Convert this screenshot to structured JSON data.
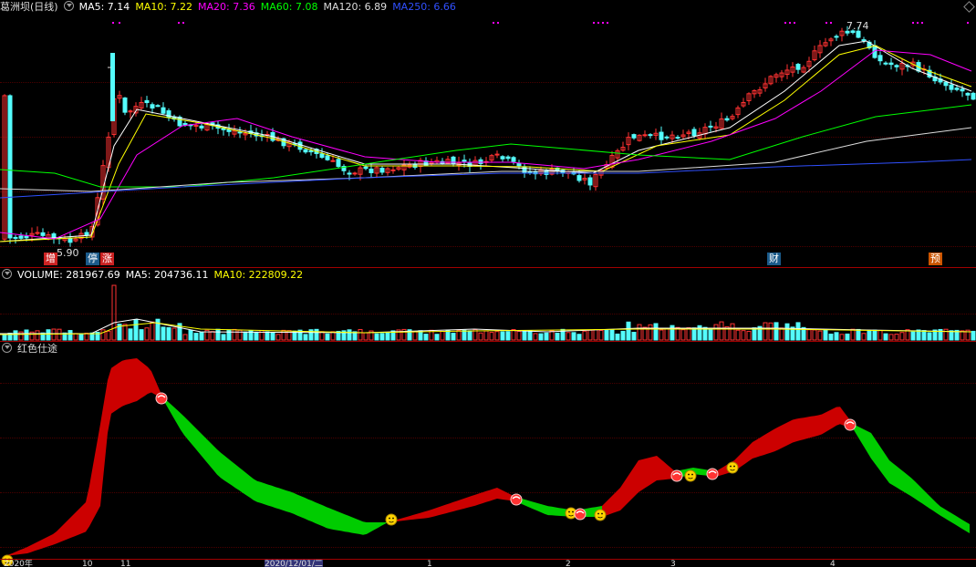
{
  "main": {
    "title": "葛洲坝(日线)",
    "ma": [
      {
        "label": "MA5: 7.14",
        "color": "#ffffff"
      },
      {
        "label": "MA10: 7.22",
        "color": "#ffff00"
      },
      {
        "label": "MA20: 7.36",
        "color": "#ff00ff"
      },
      {
        "label": "MA60: 7.08",
        "color": "#00ff00"
      },
      {
        "label": "MA120: 6.89",
        "color": "#dddddd"
      },
      {
        "label": "MA250: 6.66",
        "color": "#3050ff"
      }
    ],
    "high_label": "7.74",
    "low_label": "5.90",
    "badges": [
      {
        "text": "增",
        "bg": "#cc2222"
      },
      {
        "text": "停",
        "bg": "#1a5a8a"
      },
      {
        "text": "涨",
        "bg": "#cc2222"
      },
      {
        "text": "财",
        "bg": "#1a5a8a"
      },
      {
        "text": "预",
        "bg": "#cc5500"
      }
    ]
  },
  "volume": {
    "items": [
      {
        "label": "VOLUME: 281967.69",
        "color": "#ffffff"
      },
      {
        "label": "MA5: 204736.11",
        "color": "#ffffff"
      },
      {
        "label": "MA10: 222809.22",
        "color": "#ffff00"
      }
    ]
  },
  "indicator": {
    "title": "红色仕途"
  },
  "axis": {
    "labels": [
      "2020年",
      "10",
      "11",
      "2020/12/01/二",
      "1",
      "2",
      "3",
      "4"
    ]
  },
  "chart_data": {
    "type": "candlestick",
    "price_high": 7.74,
    "price_low": 5.9,
    "ma_values": {
      "MA5": 7.14,
      "MA10": 7.22,
      "MA20": 7.36,
      "MA60": 7.08,
      "MA120": 6.89,
      "MA250": 6.66
    },
    "volume_values": {
      "VOLUME": 281967.69,
      "MA5": 204736.11,
      "MA10": 222809.22
    },
    "indicator_name": "红色仕途"
  },
  "colors": {
    "up": "#ff3232",
    "down": "#54fcfc",
    "grid": "#4a0000",
    "separator": "#a00000",
    "band_red": "#cc0000",
    "band_green": "#00cc00"
  },
  "icons": [
    "collapse-icon",
    "settings-diamond-icon",
    "sell-signal-icon",
    "smiley-icon"
  ]
}
